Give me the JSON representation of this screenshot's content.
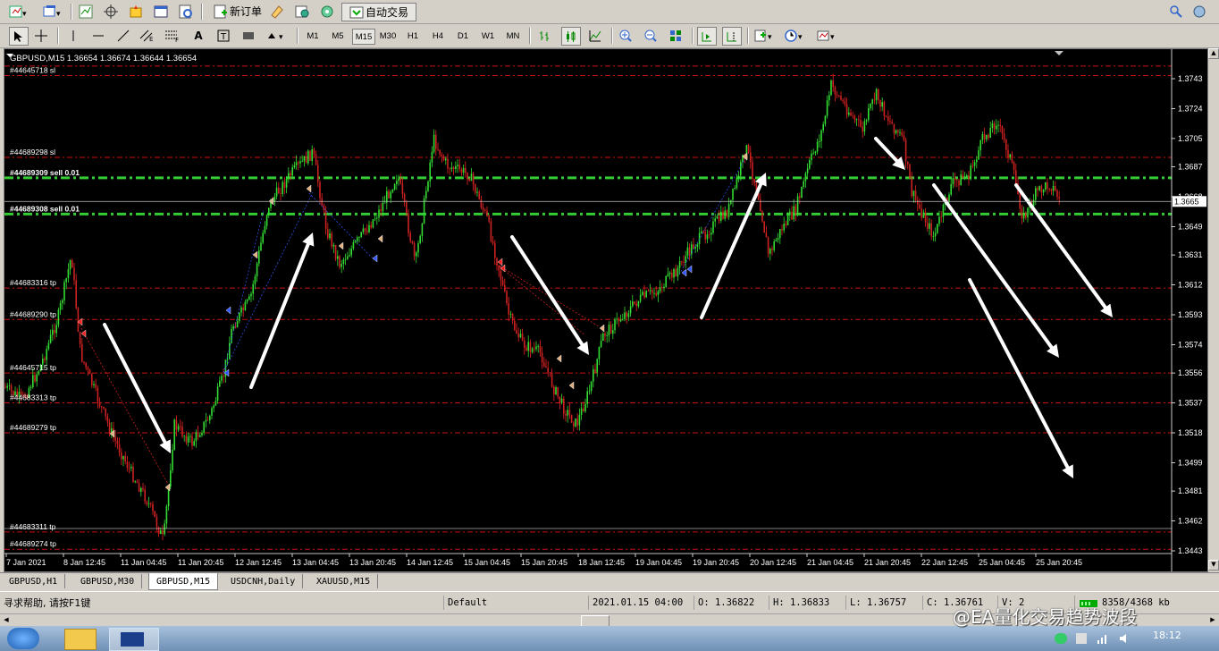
{
  "toolbar": {
    "new_order": "新订单",
    "auto_trading": "自动交易",
    "timeframes": [
      "M1",
      "M5",
      "M15",
      "M30",
      "H1",
      "H4",
      "D1",
      "W1",
      "MN"
    ],
    "active_timeframe": "M15"
  },
  "chart": {
    "header": "GBPUSD,M15  1.36654 1.36674 1.36644 1.36654",
    "current_price": "1.3665",
    "price_labels": [
      "1.3743",
      "1.3724",
      "1.3705",
      "1.3687",
      "1.3668",
      "1.3649",
      "1.3631",
      "1.3612",
      "1.3593",
      "1.3574",
      "1.3556",
      "1.3537",
      "1.3518",
      "1.3499",
      "1.3481",
      "1.3462",
      "1.3443"
    ],
    "time_labels": [
      "7 Jan 2021",
      "8 Jan 12:45",
      "11 Jan 04:45",
      "11 Jan 20:45",
      "12 Jan 12:45",
      "13 Jan 04:45",
      "13 Jan 20:45",
      "14 Jan 12:45",
      "15 Jan 04:45",
      "15 Jan 20:45",
      "18 Jan 12:45",
      "19 Jan 04:45",
      "19 Jan 20:45",
      "20 Jan 12:45",
      "21 Jan 04:45",
      "21 Jan 20:45",
      "22 Jan 12:45",
      "25 Jan 04:45",
      "25 Jan 20:45"
    ],
    "order_labels": [
      {
        "text": "#44645718 sl",
        "price": 1.3745
      },
      {
        "text": "#44689298 sl",
        "price": 1.3693
      },
      {
        "text": "#44689309 sell 0.01",
        "price": 1.368
      },
      {
        "text": "#44689308 sell 0.01",
        "price": 1.3657
      },
      {
        "text": "#44683316 tp",
        "price": 1.361
      },
      {
        "text": "#44689290 tp",
        "price": 1.359
      },
      {
        "text": "#44645715 tp",
        "price": 1.3556
      },
      {
        "text": "#44683313 tp",
        "price": 1.3537
      },
      {
        "text": "#44689279 tp",
        "price": 1.3518
      },
      {
        "text": "#44683311 tp",
        "price": 1.3455
      },
      {
        "text": "#44689274 tp",
        "price": 1.3444
      }
    ]
  },
  "tabs": [
    "GBPUSD,H1",
    "GBPUSD,M30",
    "GBPUSD,M15",
    "USDCNH,Daily",
    "XAUUSD,M15"
  ],
  "active_tab": "GBPUSD,M15",
  "status": {
    "help": "寻求帮助, 请按F1键",
    "profile": "Default",
    "datetime": "2021.01.15 04:00",
    "open": "O: 1.36822",
    "high": "H: 1.36833",
    "low": "L: 1.36757",
    "close": "C: 1.36761",
    "volume": "V: 2",
    "traffic": "8358/4368 kb"
  },
  "watermark": "@EA量化交易趋势波段",
  "clock": "18:12"
}
